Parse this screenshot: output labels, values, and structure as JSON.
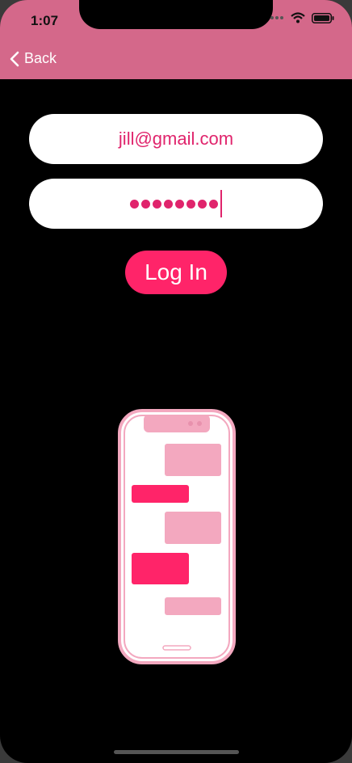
{
  "status_bar": {
    "time": "1:07"
  },
  "nav": {
    "back_label": "Back"
  },
  "form": {
    "email_value": "jill@gmail.com",
    "password_length": 8,
    "login_label": "Log In"
  },
  "colors": {
    "accent": "#ff2469",
    "header": "#d4688a",
    "text_accent": "#e0246c",
    "light_pink": "#f3a8bf"
  },
  "illustration": {
    "name": "phone-chat-illustration"
  }
}
